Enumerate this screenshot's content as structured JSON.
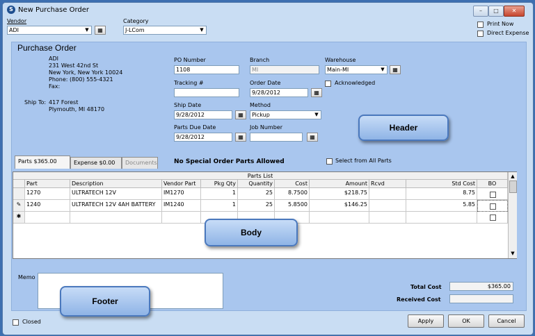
{
  "window": {
    "title": "New Purchase Order"
  },
  "top": {
    "vendor_label": "Vendor",
    "vendor_value": "ADI",
    "category_label": "Category",
    "category_value": "J-LCom",
    "print_now": "Print Now",
    "direct_expense": "Direct Expense"
  },
  "po": {
    "heading": "Purchase Order",
    "vendor_name": "ADI",
    "address1": "231 West 42nd St",
    "address2": "New York, New York  10024",
    "phone": "Phone: (800) 555-4321",
    "fax": "Fax:",
    "ship_to_label": "Ship To:",
    "ship_to1": "417 Forest",
    "ship_to2": "Plymouth, MI  48170",
    "po_number_label": "PO Number",
    "po_number": "1108",
    "tracking_label": "Tracking #",
    "tracking": "",
    "ship_date_label": "Ship Date",
    "ship_date": "9/28/2012",
    "parts_due_label": "Parts Due Date",
    "parts_due": "9/28/2012",
    "branch_label": "Branch",
    "branch": "MI",
    "order_date_label": "Order Date",
    "order_date": "9/28/2012",
    "method_label": "Method",
    "method": "Pickup",
    "job_number_label": "Job Number",
    "job_number": "",
    "warehouse_label": "Warehouse",
    "warehouse": "Main-MI",
    "acknowledged": "Acknowledged"
  },
  "tabs": [
    {
      "label": "Parts  $365.00"
    },
    {
      "label": "Expense  $0.00"
    },
    {
      "label": "Documents"
    }
  ],
  "notice": "No Special Order Parts Allowed",
  "select_all": "Select from All Parts",
  "grid": {
    "caption": "Parts List",
    "columns": [
      "Part",
      "Description",
      "Vendor Part",
      "Pkg Qty",
      "Quantity",
      "Cost",
      "Amount",
      "Rcvd",
      "Std Cost",
      "BO"
    ],
    "rows": [
      {
        "part": "1270",
        "description": "ULTRATECH 12V",
        "vendor_part": "IM1270",
        "pkg_qty": "1",
        "quantity": "25",
        "cost": "8.7500",
        "amount": "$218.75",
        "rcvd": "",
        "std_cost": "8.75"
      },
      {
        "part": "1240",
        "description": "ULTRATECH 12V 4AH BATTERY",
        "vendor_part": "IM1240",
        "pkg_qty": "1",
        "quantity": "25",
        "cost": "5.8500",
        "amount": "$146.25",
        "rcvd": "",
        "std_cost": "5.85"
      }
    ]
  },
  "overlays": {
    "header": "Header",
    "body": "Body",
    "footer": "Footer"
  },
  "footer": {
    "memo_label": "Memo",
    "total_cost_label": "Total Cost",
    "total_cost": "$365.00",
    "received_cost_label": "Received Cost",
    "received_cost": "",
    "closed": "Closed",
    "apply": "Apply",
    "ok": "OK",
    "cancel": "Cancel"
  },
  "icons": {
    "app": "app-icon",
    "grid": "grid-icon",
    "calendar": "calendar-icon"
  }
}
